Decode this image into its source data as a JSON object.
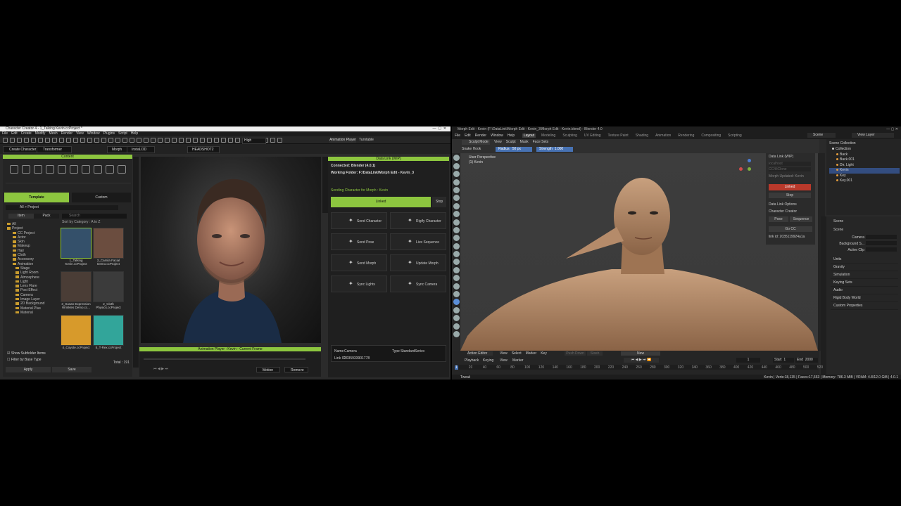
{
  "cc": {
    "title": "Character Creator 4 - 1_Talking Kevin.ccProject *",
    "menu": [
      "File",
      "Edit",
      "Create",
      "Modify",
      "Mesh",
      "Render",
      "View",
      "Window",
      "Plugins",
      "Script",
      "Help"
    ],
    "toolbar": {
      "quality": "High",
      "create_character": "Create Character",
      "transformer": "Transformer",
      "morph": "Morph",
      "lod": "InstaLOD",
      "headshot": "HEADSHOT2",
      "animation_player": "Animation Player",
      "turntable": "Turntable"
    },
    "content": {
      "title": "Content",
      "tabs": [
        "Template",
        "Custom"
      ],
      "breadcrumb": [
        "All",
        "Project"
      ],
      "subtabs": [
        "Item",
        "Pack"
      ],
      "search_placeholder": "Search",
      "sort": "Sort by Category : A to Z",
      "tree": [
        "All",
        "Project",
        "CC Project",
        "Actor",
        "Skin",
        "Makeup",
        "Hair",
        "Cloth",
        "Accessory",
        "Animation",
        "Stage",
        "Light Room",
        "Atmosphere",
        "Light",
        "Lens Flare",
        "Post Effect",
        "Camera",
        "Image Layer",
        "2D Background",
        "Material Plus",
        "Material"
      ],
      "items": [
        {
          "label": "1_Talking Kevin.ccProject"
        },
        {
          "label": "2_Camila Facial Demo.ccProject"
        },
        {
          "label": "3_Susan Expression Wrinkles Demo.cc..."
        },
        {
          "label": "2_Cloth Physics.ccProject"
        },
        {
          "label": "4_Coyote.ccProject"
        },
        {
          "label": "5_T-Rex.ccProject"
        }
      ],
      "total": "Total : 191",
      "show_subfolder": "Show Subfolder Items",
      "filter_base": "Filter by Base Type",
      "apply": "Apply",
      "save": "Save"
    },
    "side_tabs": [
      "Content",
      "Scene",
      "Visual"
    ],
    "anim_player": {
      "title": "Animation Player : Kevin - Current Frame",
      "motion": "Motion",
      "remove": "Remove"
    },
    "datalink": {
      "title": "Data Link (WIP)",
      "connected": "Connected: Blender (4.0.1)",
      "folder": "Working Folder: F:\\DataLink\\Morph Edit - Kevin_3",
      "sending": "Sending Character for Morph : Kevin",
      "linked": "Linked",
      "stop": "Stop",
      "buttons": [
        "Send Character",
        "Rigify Character",
        "Send Pose",
        "Live Sequence",
        "Send Morph",
        "Update Morph",
        "Sync Lights",
        "Sync Camera"
      ],
      "name_label": "Name",
      "name_value": "Camera",
      "type_label": "Type",
      "type_value": "StandardSeries",
      "link_label": "Link ID",
      "link_value": "2035933901778"
    }
  },
  "blender": {
    "title": "Morph Edit - Kevin (F:\\DataLink\\Morph Edit - Kevin_3\\Morph Edit - Kevin.blend) - Blender 4.0",
    "menu": [
      "File",
      "Edit",
      "Render",
      "Window",
      "Help"
    ],
    "workspaces": [
      "Layout",
      "Modeling",
      "Sculpting",
      "UV Editing",
      "Texture Paint",
      "Shading",
      "Animation",
      "Rendering",
      "Compositing",
      "Scripting"
    ],
    "scene": "Scene",
    "view_layer": "View Layer",
    "mode": "Sculpt Mode",
    "header_menu": [
      "View",
      "Sculpt",
      "Mask",
      "Face Sets"
    ],
    "brush": "Snake Hook",
    "radius_label": "Radius",
    "radius_value": "50 px",
    "strength_label": "Strength",
    "strength_value": "1.000",
    "viewport": {
      "perspective": "User Perspective",
      "object": "(1) Kevin"
    },
    "datalink": {
      "title": "Data Link (WIP)",
      "host": "localhost",
      "target": "CC4/iClone",
      "morph_status": "Morph Updated: Kevin",
      "linked": "Linked",
      "stop": "Stop",
      "options": "Data Link Options",
      "creator": "Character Creator",
      "pose": "Pose",
      "sequence": "Sequence",
      "go_cc": "Go CC",
      "link_id": "link id: 2035119924a1a"
    },
    "outliner": {
      "title": "Scene Collection",
      "items": [
        "Collection",
        "Back",
        "Back.001",
        "Dir. Light",
        "Kevin",
        "Key",
        "Key.001"
      ]
    },
    "properties": {
      "scene": "Scene",
      "header": "Scene",
      "camera": "Camera",
      "background": "Background S...",
      "active_clip": "Active Clip",
      "panels": [
        "Units",
        "Gravity",
        "Simulation",
        "Keying Sets",
        "Audio",
        "Rigid Body World",
        "Custom Properties"
      ]
    },
    "timeline": {
      "editor": "Action Editor",
      "menu": [
        "View",
        "Select",
        "Marker",
        "Key"
      ],
      "push_down": "Push Down",
      "stash": "Stash",
      "new": "New",
      "playback": "Playback",
      "keying": "Keying",
      "current": "1",
      "start_label": "Start",
      "start": "1",
      "end_label": "End",
      "end": "2000",
      "ticks": [
        "1",
        "20",
        "40",
        "60",
        "80",
        "100",
        "120",
        "140",
        "160",
        "180",
        "200",
        "220",
        "240",
        "260",
        "280",
        "300",
        "320",
        "340",
        "360",
        "380",
        "400",
        "420",
        "440",
        "460",
        "480",
        "500",
        "520"
      ]
    },
    "status": {
      "left": "Tweak",
      "right": "Kevin | Verts:18,135 | Faces:17,663 | Memory: 786.3 MiB | VRAM: 4.8/12.0 GiB | 4.0.1"
    }
  },
  "colors": {
    "green": "#8dc63f",
    "blender_accent": "#4772b3",
    "linked_red": "#c0392b"
  }
}
